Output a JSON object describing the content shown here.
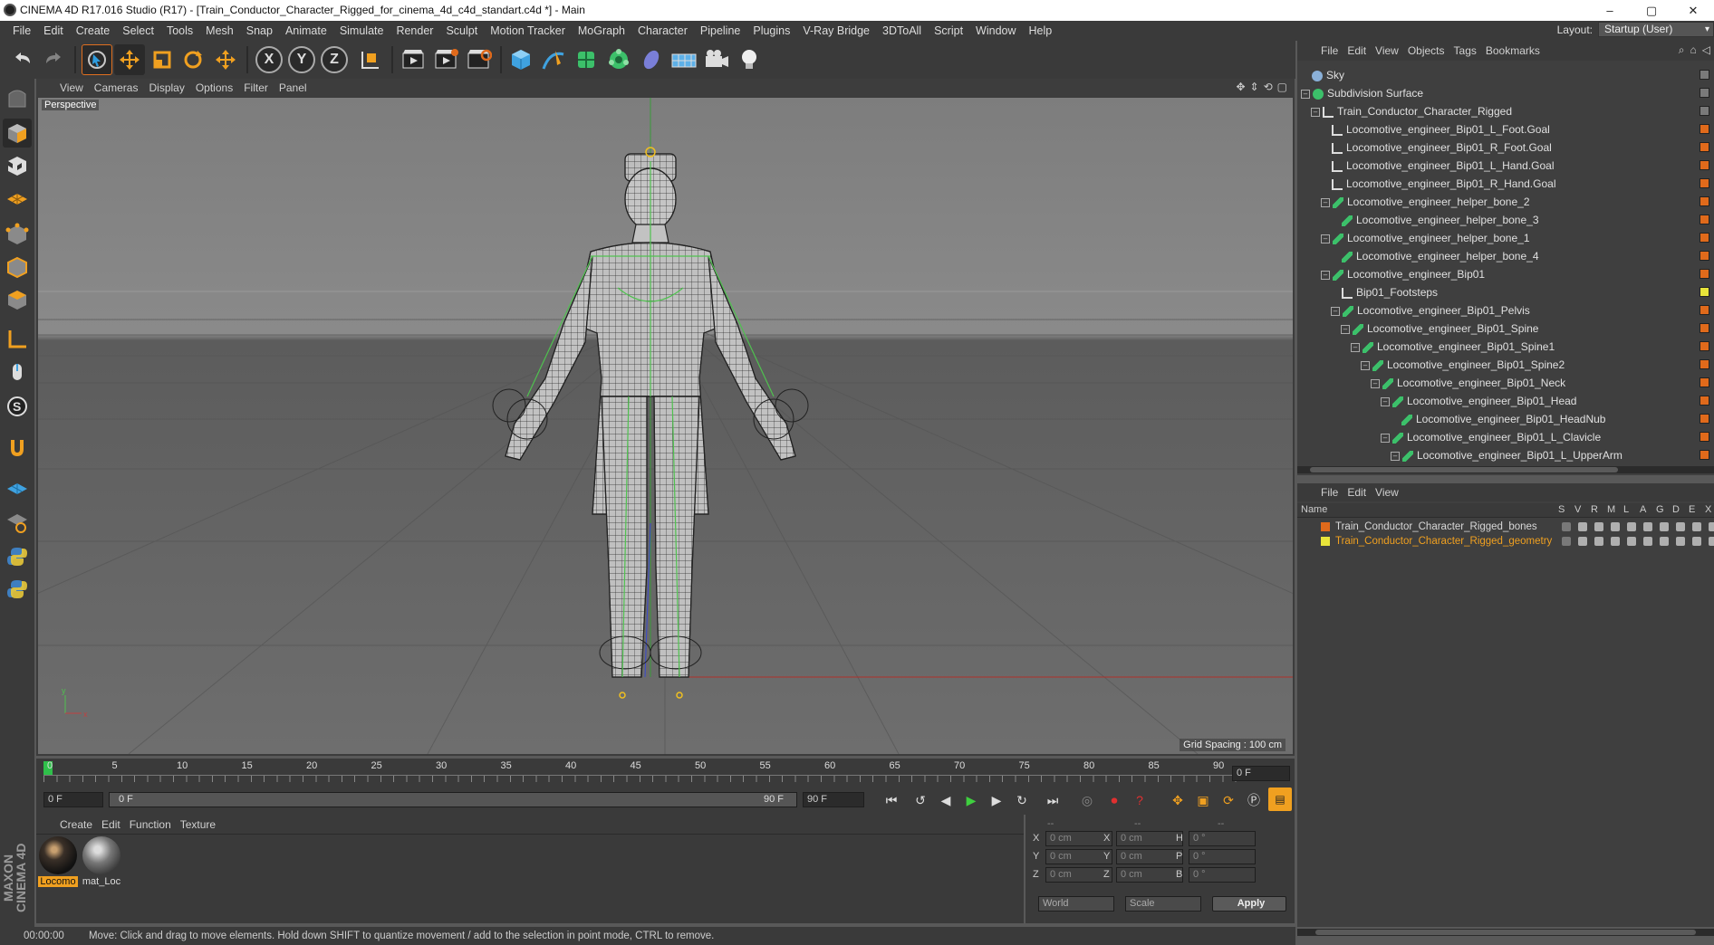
{
  "window": {
    "title": "CINEMA 4D R17.016 Studio (R17) - [Train_Conductor_Character_Rigged_for_cinema_4d_c4d_standart.c4d *] - Main",
    "controls": [
      "–",
      "▢",
      "✕"
    ]
  },
  "menubar": {
    "items": [
      "File",
      "Edit",
      "Create",
      "Select",
      "Tools",
      "Mesh",
      "Snap",
      "Animate",
      "Simulate",
      "Render",
      "Sculpt",
      "Motion Tracker",
      "MoGraph",
      "Character",
      "Pipeline",
      "Plugins",
      "V-Ray Bridge",
      "3DToAll",
      "Script",
      "Window",
      "Help"
    ],
    "layout_label": "Layout:",
    "layout_value": "Startup (User)"
  },
  "toolbar": {
    "axis_x": "X",
    "axis_y": "Y",
    "axis_z": "Z"
  },
  "viewport": {
    "menu": [
      "View",
      "Cameras",
      "Display",
      "Options",
      "Filter",
      "Panel"
    ],
    "label": "Perspective",
    "grid_spacing": "Grid Spacing : 100 cm"
  },
  "timeline": {
    "ticks": [
      "0",
      "5",
      "10",
      "15",
      "20",
      "25",
      "30",
      "35",
      "40",
      "45",
      "50",
      "55",
      "60",
      "65",
      "70",
      "75",
      "80",
      "85",
      "90"
    ],
    "current_frame": "0 F",
    "start_field": "0 F",
    "range_start": "0 F",
    "range_end": "90 F",
    "end_field": "90 F"
  },
  "materials": {
    "menu": [
      "Create",
      "Edit",
      "Function",
      "Texture"
    ],
    "items": [
      {
        "label": "Locomo",
        "selected": true
      },
      {
        "label": "mat_Loc",
        "selected": false
      }
    ]
  },
  "coordinates": {
    "header_left": "--",
    "header_mid": "--",
    "header_right": "--",
    "rows": [
      {
        "a": "X",
        "av": "0 cm",
        "b": "X",
        "bv": "0 cm",
        "c": "H",
        "cv": "0 °"
      },
      {
        "a": "Y",
        "av": "0 cm",
        "b": "Y",
        "bv": "0 cm",
        "c": "P",
        "cv": "0 °"
      },
      {
        "a": "Z",
        "av": "0 cm",
        "b": "Z",
        "bv": "0 cm",
        "c": "B",
        "cv": "0 °"
      }
    ],
    "space": "World",
    "mode": "Scale",
    "apply": "Apply"
  },
  "status": {
    "time": "00:00:00",
    "message": "Move: Click and drag to move elements. Hold down SHIFT to quantize movement / add to the selection in point mode, CTRL to remove."
  },
  "object_manager": {
    "menu": [
      "File",
      "Edit",
      "View",
      "Objects",
      "Tags",
      "Bookmarks"
    ],
    "objects": [
      {
        "name": "Sky",
        "indent": 0,
        "fold": "",
        "icon": "sky"
      },
      {
        "name": "Subdivision Surface",
        "indent": 0,
        "fold": "–",
        "icon": "subdiv"
      },
      {
        "name": "Train_Conductor_Character_Rigged",
        "indent": 1,
        "fold": "–",
        "icon": "null"
      },
      {
        "name": "Locomotive_engineer_Bip01_L_Foot.Goal",
        "indent": 2,
        "fold": "",
        "icon": "null"
      },
      {
        "name": "Locomotive_engineer_Bip01_R_Foot.Goal",
        "indent": 2,
        "fold": "",
        "icon": "null"
      },
      {
        "name": "Locomotive_engineer_Bip01_L_Hand.Goal",
        "indent": 2,
        "fold": "",
        "icon": "null"
      },
      {
        "name": "Locomotive_engineer_Bip01_R_Hand.Goal",
        "indent": 2,
        "fold": "",
        "icon": "null"
      },
      {
        "name": "Locomotive_engineer_helper_bone_2",
        "indent": 2,
        "fold": "–",
        "icon": "bone"
      },
      {
        "name": "Locomotive_engineer_helper_bone_3",
        "indent": 3,
        "fold": "",
        "icon": "bone"
      },
      {
        "name": "Locomotive_engineer_helper_bone_1",
        "indent": 2,
        "fold": "–",
        "icon": "bone"
      },
      {
        "name": "Locomotive_engineer_helper_bone_4",
        "indent": 3,
        "fold": "",
        "icon": "bone"
      },
      {
        "name": "Locomotive_engineer_Bip01",
        "indent": 2,
        "fold": "–",
        "icon": "bone"
      },
      {
        "name": "Bip01_Footsteps",
        "indent": 3,
        "fold": "",
        "icon": "null"
      },
      {
        "name": "Locomotive_engineer_Bip01_Pelvis",
        "indent": 3,
        "fold": "–",
        "icon": "bone"
      },
      {
        "name": "Locomotive_engineer_Bip01_Spine",
        "indent": 4,
        "fold": "–",
        "icon": "bone"
      },
      {
        "name": "Locomotive_engineer_Bip01_Spine1",
        "indent": 5,
        "fold": "–",
        "icon": "bone"
      },
      {
        "name": "Locomotive_engineer_Bip01_Spine2",
        "indent": 6,
        "fold": "–",
        "icon": "bone"
      },
      {
        "name": "Locomotive_engineer_Bip01_Neck",
        "indent": 7,
        "fold": "–",
        "icon": "bone"
      },
      {
        "name": "Locomotive_engineer_Bip01_Head",
        "indent": 8,
        "fold": "–",
        "icon": "bone"
      },
      {
        "name": "Locomotive_engineer_Bip01_HeadNub",
        "indent": 9,
        "fold": "",
        "icon": "bone"
      },
      {
        "name": "Locomotive_engineer_Bip01_L_Clavicle",
        "indent": 8,
        "fold": "–",
        "icon": "bone"
      },
      {
        "name": "Locomotive_engineer_Bip01_L_UpperArm",
        "indent": 9,
        "fold": "–",
        "icon": "bone"
      }
    ],
    "layer_colors": [
      "#7a7a7a",
      "#7a7a7a",
      "#7a7a7a",
      "#e06a1b",
      "#e06a1b",
      "#e06a1b",
      "#e06a1b",
      "#e06a1b",
      "#e06a1b",
      "#e06a1b",
      "#e06a1b",
      "#e06a1b",
      "#e8e43a",
      "#e06a1b",
      "#e06a1b",
      "#e06a1b",
      "#e06a1b",
      "#e06a1b",
      "#e06a1b",
      "#e06a1b",
      "#e06a1b",
      "#e06a1b"
    ]
  },
  "layer_manager": {
    "menu": [
      "File",
      "Edit",
      "View"
    ],
    "columns": [
      "Name",
      "S",
      "V",
      "R",
      "M",
      "L",
      "A",
      "G",
      "D",
      "E",
      "X"
    ],
    "layers": [
      {
        "name": "Train_Conductor_Character_Rigged_bones",
        "color": "#e06a1b",
        "text_color": "#d8d8d8"
      },
      {
        "name": "Train_Conductor_Character_Rigged_geometry",
        "color": "#e8e43a",
        "text_color": "#f0a020"
      }
    ]
  }
}
